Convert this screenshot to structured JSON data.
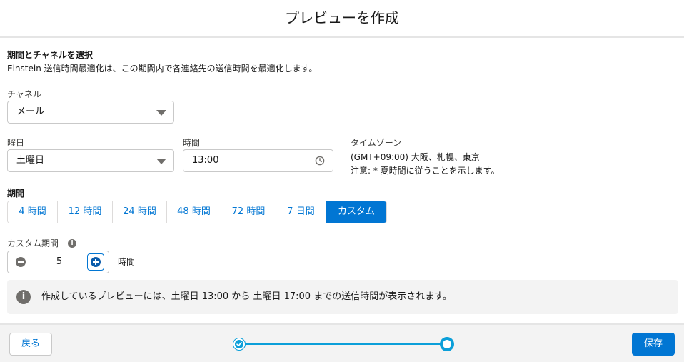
{
  "header": {
    "title": "プレビューを作成"
  },
  "section": {
    "title": "期間とチャネルを選択",
    "description": "Einstein 送信時間最適化は、この期間内で各連絡先の送信時間を最適化します。"
  },
  "channel": {
    "label": "チャネル",
    "value": "メール"
  },
  "day": {
    "label": "曜日",
    "value": "土曜日"
  },
  "time": {
    "label": "時間",
    "value": "13:00"
  },
  "timezone": {
    "label": "タイムゾーン",
    "value": "(GMT+09:00) 大阪、札幌、東京",
    "note": "注意: * 夏時間に従うことを示します。"
  },
  "period": {
    "label": "期間",
    "options": [
      "4 時間",
      "12 時間",
      "24 時間",
      "48 時間",
      "72 時間",
      "7 日間",
      "カスタム"
    ],
    "selected": "カスタム"
  },
  "custom_period": {
    "label": "カスタム期間",
    "value": "5",
    "unit": "時間"
  },
  "notice": {
    "text": "作成しているプレビューには、土曜日 13:00 から 土曜日 17:00 までの送信時間が表示されます。"
  },
  "footer": {
    "back_label": "戻る",
    "save_label": "保存"
  },
  "colors": {
    "brand": "#0176d3",
    "progress": "#0b9fd9",
    "notice_bg": "#f3f3f3"
  },
  "progress": {
    "total_steps": 2,
    "current_step": 2
  }
}
